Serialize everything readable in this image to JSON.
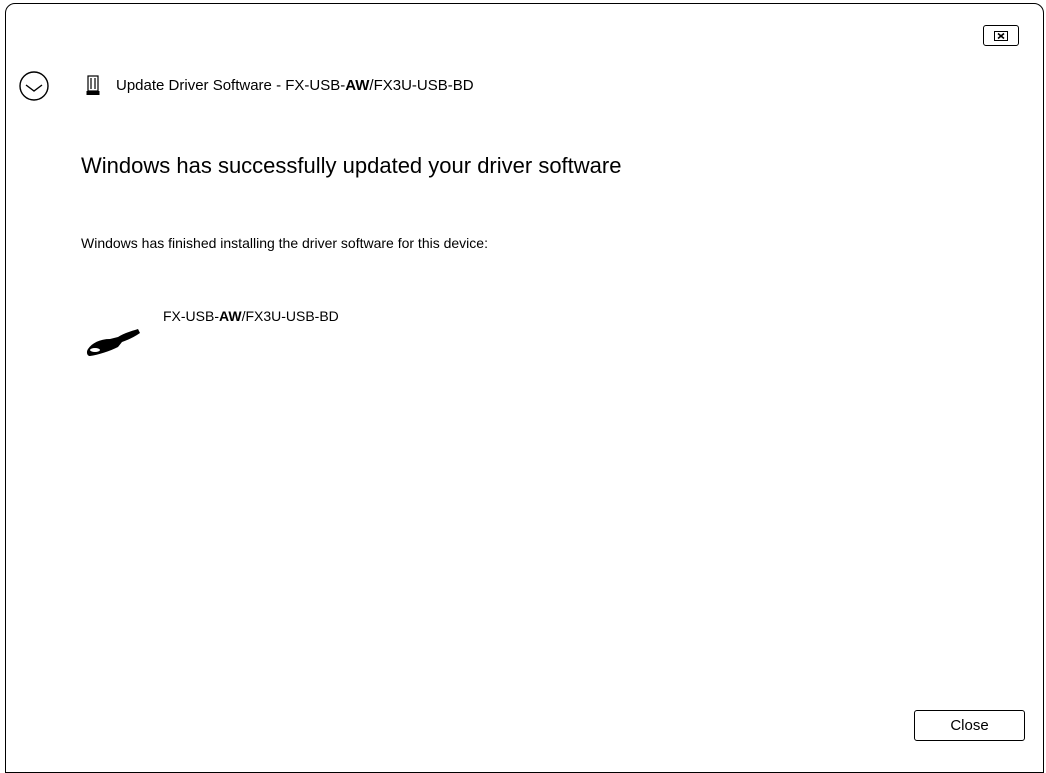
{
  "window": {
    "title_prefix": "Update Driver Software - FX-USB-",
    "title_bold": "AW",
    "title_suffix": "/FX3U-USB-BD",
    "close_x_icon": "close-x-icon",
    "back_icon": "back-arrow-icon",
    "title_device_icon": "usb-device-icon"
  },
  "content": {
    "heading": "Windows has successfully updated your driver software",
    "description": "Windows has finished installing the driver software for this device:",
    "device": {
      "name_prefix": "FX-USB-",
      "name_bold": "AW",
      "name_suffix": "/FX3U-USB-BD",
      "icon": "usb-cable-icon"
    }
  },
  "footer": {
    "close_label": "Close"
  },
  "colors": {
    "background": "#ffffff",
    "text": "#000000",
    "border": "#000000"
  }
}
